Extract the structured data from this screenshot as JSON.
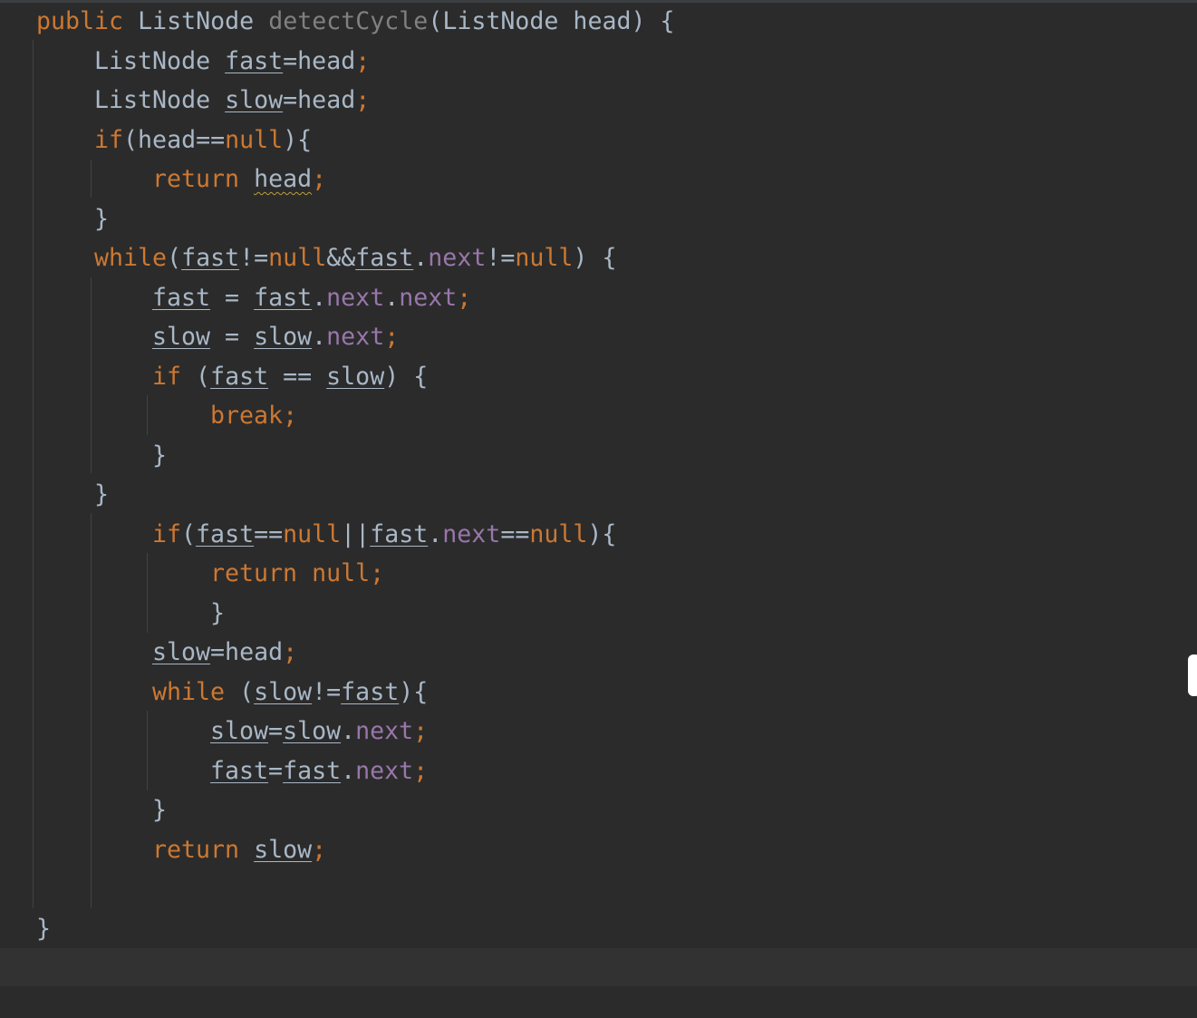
{
  "editor": {
    "lines": [
      {
        "indent": 0,
        "tokens": [
          {
            "t": "public",
            "c": "kw"
          },
          {
            "t": " ",
            "c": "op"
          },
          {
            "t": "ListNode",
            "c": "ty"
          },
          {
            "t": " ",
            "c": "op"
          },
          {
            "t": "detectCycle",
            "c": "fn"
          },
          {
            "t": "(ListNode head) {",
            "c": "op"
          }
        ]
      },
      {
        "indent": 1,
        "tokens": [
          {
            "t": "ListNode",
            "c": "ty"
          },
          {
            "t": " ",
            "c": "op"
          },
          {
            "t": "fast",
            "c": "var"
          },
          {
            "t": "=head",
            "c": "op"
          },
          {
            "t": ";",
            "c": "semi"
          }
        ]
      },
      {
        "indent": 1,
        "tokens": [
          {
            "t": "ListNode",
            "c": "ty"
          },
          {
            "t": " ",
            "c": "op"
          },
          {
            "t": "slow",
            "c": "var"
          },
          {
            "t": "=head",
            "c": "op"
          },
          {
            "t": ";",
            "c": "semi"
          }
        ]
      },
      {
        "indent": 1,
        "tokens": [
          {
            "t": "if",
            "c": "kw"
          },
          {
            "t": "(head==",
            "c": "op"
          },
          {
            "t": "null",
            "c": "kw"
          },
          {
            "t": "){",
            "c": "op"
          }
        ]
      },
      {
        "indent": 2,
        "tokens": [
          {
            "t": "return",
            "c": "kw"
          },
          {
            "t": " ",
            "c": "op"
          },
          {
            "t": "head",
            "c": "warn"
          },
          {
            "t": ";",
            "c": "semi"
          }
        ]
      },
      {
        "indent": 1,
        "tokens": [
          {
            "t": "}",
            "c": "op"
          }
        ]
      },
      {
        "indent": 1,
        "tokens": [
          {
            "t": "while",
            "c": "kw"
          },
          {
            "t": "(",
            "c": "op"
          },
          {
            "t": "fast",
            "c": "var"
          },
          {
            "t": "!=",
            "c": "op"
          },
          {
            "t": "null",
            "c": "kw"
          },
          {
            "t": "&&",
            "c": "op"
          },
          {
            "t": "fast",
            "c": "var"
          },
          {
            "t": ".",
            "c": "op"
          },
          {
            "t": "next",
            "c": "fld"
          },
          {
            "t": "!=",
            "c": "op"
          },
          {
            "t": "null",
            "c": "kw"
          },
          {
            "t": ") {",
            "c": "op"
          }
        ]
      },
      {
        "indent": 2,
        "tokens": [
          {
            "t": "fast",
            "c": "var"
          },
          {
            "t": " = ",
            "c": "op"
          },
          {
            "t": "fast",
            "c": "var"
          },
          {
            "t": ".",
            "c": "op"
          },
          {
            "t": "next",
            "c": "fld"
          },
          {
            "t": ".",
            "c": "op"
          },
          {
            "t": "next",
            "c": "fld"
          },
          {
            "t": ";",
            "c": "semi"
          }
        ]
      },
      {
        "indent": 2,
        "tokens": [
          {
            "t": "slow",
            "c": "var"
          },
          {
            "t": " = ",
            "c": "op"
          },
          {
            "t": "slow",
            "c": "var"
          },
          {
            "t": ".",
            "c": "op"
          },
          {
            "t": "next",
            "c": "fld"
          },
          {
            "t": ";",
            "c": "semi"
          }
        ]
      },
      {
        "indent": 2,
        "tokens": [
          {
            "t": "if",
            "c": "kw"
          },
          {
            "t": " (",
            "c": "op"
          },
          {
            "t": "fast",
            "c": "var"
          },
          {
            "t": " == ",
            "c": "op"
          },
          {
            "t": "slow",
            "c": "var"
          },
          {
            "t": ") {",
            "c": "op"
          }
        ]
      },
      {
        "indent": 3,
        "tokens": [
          {
            "t": "break",
            "c": "kw"
          },
          {
            "t": ";",
            "c": "semi"
          }
        ]
      },
      {
        "indent": 2,
        "tokens": [
          {
            "t": "}",
            "c": "op"
          }
        ]
      },
      {
        "indent": 1,
        "tokens": [
          {
            "t": "}",
            "c": "op"
          }
        ]
      },
      {
        "indent": 2,
        "tokens": [
          {
            "t": "if",
            "c": "kw"
          },
          {
            "t": "(",
            "c": "op"
          },
          {
            "t": "fast",
            "c": "var"
          },
          {
            "t": "==",
            "c": "op"
          },
          {
            "t": "null",
            "c": "kw"
          },
          {
            "t": "||",
            "c": "op"
          },
          {
            "t": "fast",
            "c": "var"
          },
          {
            "t": ".",
            "c": "op"
          },
          {
            "t": "next",
            "c": "fld"
          },
          {
            "t": "==",
            "c": "op"
          },
          {
            "t": "null",
            "c": "kw"
          },
          {
            "t": "){",
            "c": "op"
          }
        ]
      },
      {
        "indent": 3,
        "tokens": [
          {
            "t": "return",
            "c": "kw"
          },
          {
            "t": " ",
            "c": "op"
          },
          {
            "t": "null",
            "c": "kw"
          },
          {
            "t": ";",
            "c": "semi"
          }
        ]
      },
      {
        "indent": 3,
        "tokens": [
          {
            "t": "}",
            "c": "op"
          }
        ]
      },
      {
        "indent": 2,
        "tokens": [
          {
            "t": "slow",
            "c": "var"
          },
          {
            "t": "=head",
            "c": "op"
          },
          {
            "t": ";",
            "c": "semi"
          }
        ]
      },
      {
        "indent": 2,
        "tokens": [
          {
            "t": "while",
            "c": "kw"
          },
          {
            "t": " (",
            "c": "op"
          },
          {
            "t": "slow",
            "c": "var"
          },
          {
            "t": "!=",
            "c": "op"
          },
          {
            "t": "fast",
            "c": "var"
          },
          {
            "t": "){",
            "c": "op"
          }
        ]
      },
      {
        "indent": 3,
        "tokens": [
          {
            "t": "slow",
            "c": "var"
          },
          {
            "t": "=",
            "c": "op"
          },
          {
            "t": "slow",
            "c": "var"
          },
          {
            "t": ".",
            "c": "op"
          },
          {
            "t": "next",
            "c": "fld"
          },
          {
            "t": ";",
            "c": "semi"
          }
        ]
      },
      {
        "indent": 3,
        "tokens": [
          {
            "t": "fast",
            "c": "var"
          },
          {
            "t": "=",
            "c": "op"
          },
          {
            "t": "fast",
            "c": "var"
          },
          {
            "t": ".",
            "c": "op"
          },
          {
            "t": "next",
            "c": "fld"
          },
          {
            "t": ";",
            "c": "semi"
          }
        ]
      },
      {
        "indent": 2,
        "tokens": [
          {
            "t": "}",
            "c": "op"
          }
        ]
      },
      {
        "indent": 2,
        "tokens": [
          {
            "t": "return",
            "c": "kw"
          },
          {
            "t": " ",
            "c": "op"
          },
          {
            "t": "slow",
            "c": "var"
          },
          {
            "t": ";",
            "c": "semi"
          }
        ]
      },
      {
        "indent": 0,
        "tokens": []
      },
      {
        "indent": 0,
        "tokens": [
          {
            "t": "}",
            "c": "op"
          }
        ]
      }
    ]
  },
  "colors": {
    "background": "#2b2b2b",
    "keyword": "#cc7832",
    "text": "#a9b7c6",
    "method_unused": "#808080",
    "field": "#9876aa",
    "warning_underline": "#b8a13b",
    "current_line": "#323232"
  }
}
